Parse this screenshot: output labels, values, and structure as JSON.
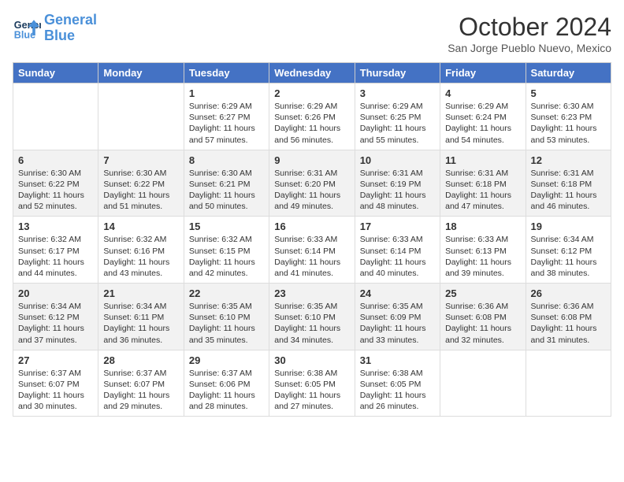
{
  "header": {
    "logo_line1": "General",
    "logo_line2": "Blue",
    "month_title": "October 2024",
    "location": "San Jorge Pueblo Nuevo, Mexico"
  },
  "days_of_week": [
    "Sunday",
    "Monday",
    "Tuesday",
    "Wednesday",
    "Thursday",
    "Friday",
    "Saturday"
  ],
  "weeks": [
    [
      {
        "day": "",
        "content": ""
      },
      {
        "day": "",
        "content": ""
      },
      {
        "day": "1",
        "content": "Sunrise: 6:29 AM\nSunset: 6:27 PM\nDaylight: 11 hours and 57 minutes."
      },
      {
        "day": "2",
        "content": "Sunrise: 6:29 AM\nSunset: 6:26 PM\nDaylight: 11 hours and 56 minutes."
      },
      {
        "day": "3",
        "content": "Sunrise: 6:29 AM\nSunset: 6:25 PM\nDaylight: 11 hours and 55 minutes."
      },
      {
        "day": "4",
        "content": "Sunrise: 6:29 AM\nSunset: 6:24 PM\nDaylight: 11 hours and 54 minutes."
      },
      {
        "day": "5",
        "content": "Sunrise: 6:30 AM\nSunset: 6:23 PM\nDaylight: 11 hours and 53 minutes."
      }
    ],
    [
      {
        "day": "6",
        "content": "Sunrise: 6:30 AM\nSunset: 6:22 PM\nDaylight: 11 hours and 52 minutes."
      },
      {
        "day": "7",
        "content": "Sunrise: 6:30 AM\nSunset: 6:22 PM\nDaylight: 11 hours and 51 minutes."
      },
      {
        "day": "8",
        "content": "Sunrise: 6:30 AM\nSunset: 6:21 PM\nDaylight: 11 hours and 50 minutes."
      },
      {
        "day": "9",
        "content": "Sunrise: 6:31 AM\nSunset: 6:20 PM\nDaylight: 11 hours and 49 minutes."
      },
      {
        "day": "10",
        "content": "Sunrise: 6:31 AM\nSunset: 6:19 PM\nDaylight: 11 hours and 48 minutes."
      },
      {
        "day": "11",
        "content": "Sunrise: 6:31 AM\nSunset: 6:18 PM\nDaylight: 11 hours and 47 minutes."
      },
      {
        "day": "12",
        "content": "Sunrise: 6:31 AM\nSunset: 6:18 PM\nDaylight: 11 hours and 46 minutes."
      }
    ],
    [
      {
        "day": "13",
        "content": "Sunrise: 6:32 AM\nSunset: 6:17 PM\nDaylight: 11 hours and 44 minutes."
      },
      {
        "day": "14",
        "content": "Sunrise: 6:32 AM\nSunset: 6:16 PM\nDaylight: 11 hours and 43 minutes."
      },
      {
        "day": "15",
        "content": "Sunrise: 6:32 AM\nSunset: 6:15 PM\nDaylight: 11 hours and 42 minutes."
      },
      {
        "day": "16",
        "content": "Sunrise: 6:33 AM\nSunset: 6:14 PM\nDaylight: 11 hours and 41 minutes."
      },
      {
        "day": "17",
        "content": "Sunrise: 6:33 AM\nSunset: 6:14 PM\nDaylight: 11 hours and 40 minutes."
      },
      {
        "day": "18",
        "content": "Sunrise: 6:33 AM\nSunset: 6:13 PM\nDaylight: 11 hours and 39 minutes."
      },
      {
        "day": "19",
        "content": "Sunrise: 6:34 AM\nSunset: 6:12 PM\nDaylight: 11 hours and 38 minutes."
      }
    ],
    [
      {
        "day": "20",
        "content": "Sunrise: 6:34 AM\nSunset: 6:12 PM\nDaylight: 11 hours and 37 minutes."
      },
      {
        "day": "21",
        "content": "Sunrise: 6:34 AM\nSunset: 6:11 PM\nDaylight: 11 hours and 36 minutes."
      },
      {
        "day": "22",
        "content": "Sunrise: 6:35 AM\nSunset: 6:10 PM\nDaylight: 11 hours and 35 minutes."
      },
      {
        "day": "23",
        "content": "Sunrise: 6:35 AM\nSunset: 6:10 PM\nDaylight: 11 hours and 34 minutes."
      },
      {
        "day": "24",
        "content": "Sunrise: 6:35 AM\nSunset: 6:09 PM\nDaylight: 11 hours and 33 minutes."
      },
      {
        "day": "25",
        "content": "Sunrise: 6:36 AM\nSunset: 6:08 PM\nDaylight: 11 hours and 32 minutes."
      },
      {
        "day": "26",
        "content": "Sunrise: 6:36 AM\nSunset: 6:08 PM\nDaylight: 11 hours and 31 minutes."
      }
    ],
    [
      {
        "day": "27",
        "content": "Sunrise: 6:37 AM\nSunset: 6:07 PM\nDaylight: 11 hours and 30 minutes."
      },
      {
        "day": "28",
        "content": "Sunrise: 6:37 AM\nSunset: 6:07 PM\nDaylight: 11 hours and 29 minutes."
      },
      {
        "day": "29",
        "content": "Sunrise: 6:37 AM\nSunset: 6:06 PM\nDaylight: 11 hours and 28 minutes."
      },
      {
        "day": "30",
        "content": "Sunrise: 6:38 AM\nSunset: 6:05 PM\nDaylight: 11 hours and 27 minutes."
      },
      {
        "day": "31",
        "content": "Sunrise: 6:38 AM\nSunset: 6:05 PM\nDaylight: 11 hours and 26 minutes."
      },
      {
        "day": "",
        "content": ""
      },
      {
        "day": "",
        "content": ""
      }
    ]
  ]
}
